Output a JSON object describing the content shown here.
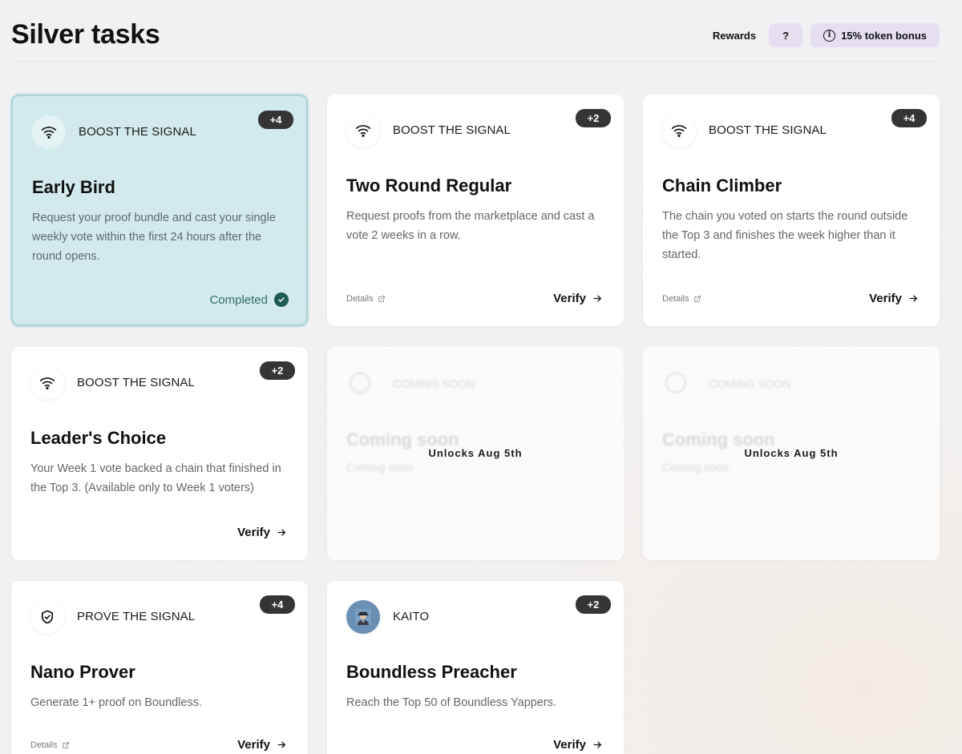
{
  "header": {
    "title": "Silver tasks",
    "rewards_label": "Rewards",
    "help_label": "?",
    "bonus_label": "15% token bonus",
    "bonus_icon": "info-icon",
    "accent_color": "#e6dff1"
  },
  "cards": [
    {
      "category": "BOOST THE SIGNAL",
      "icon": "wifi-icon",
      "points": "+4",
      "title": "Early Bird",
      "description": "Request your proof bundle and cast your single weekly vote within the first 24 hours after the round opens.",
      "status": "Completed",
      "status_color": "#2e6e64"
    },
    {
      "category": "BOOST THE SIGNAL",
      "icon": "wifi-icon",
      "points": "+2",
      "title": "Two Round Regular",
      "description": "Request proofs from the marketplace and cast a vote 2 weeks in a row.",
      "details_label": "Details",
      "action_label": "Verify"
    },
    {
      "category": "BOOST THE SIGNAL",
      "icon": "wifi-icon",
      "points": "+4",
      "title": "Chain Climber",
      "description": "The chain you voted on starts the round outside the Top 3 and finishes the week higher than it started.",
      "details_label": "Details",
      "action_label": "Verify"
    },
    {
      "category": "BOOST THE SIGNAL",
      "icon": "wifi-icon",
      "points": "+2",
      "title": "Leader's Choice",
      "description": "Your Week 1 vote backed a chain that finished in the Top 3. (Available only to Week 1 voters)",
      "action_label": "Verify"
    },
    {
      "locked": true,
      "ghost_category": "COMING SOON",
      "ghost_title": "Coming soon",
      "ghost_desc": "Coming soon",
      "unlock_label": "Unlocks Aug 5th"
    },
    {
      "locked": true,
      "ghost_category": "COMING SOON",
      "ghost_title": "Coming soon",
      "ghost_desc": "Coming soon",
      "unlock_label": "Unlocks Aug 5th"
    },
    {
      "category": "PROVE THE SIGNAL",
      "icon": "shield-check-icon",
      "points": "+4",
      "title": "Nano Prover",
      "description": "Generate 1+ proof on Boundless.",
      "details_label": "Details",
      "action_label": "Verify"
    },
    {
      "category": "KAITO",
      "icon": "kaito-avatar-icon",
      "points": "+2",
      "title": "Boundless Preacher",
      "description": "Reach the Top 50 of Boundless Yappers.",
      "action_label": "Verify"
    }
  ]
}
